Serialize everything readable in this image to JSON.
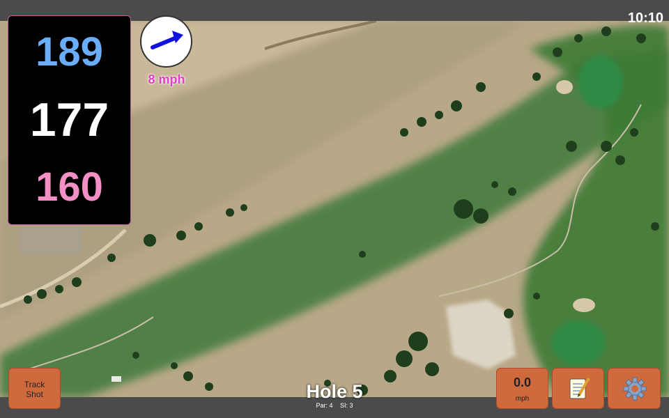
{
  "status": {
    "time": "10:10"
  },
  "distances": {
    "back": "189",
    "middle": "177",
    "front": "160",
    "colors": {
      "back": "#6aaefa",
      "middle": "#ffffff",
      "front": "#f48fc6"
    }
  },
  "wind": {
    "speed_label": "8 mph",
    "direction_icon": "arrow-right-up-icon",
    "arrow_color": "#1010e0"
  },
  "map": {
    "style": "satellite",
    "colors": {
      "rough": "#b9a98a",
      "fairway": "#3f7a3a",
      "green": "#2f8a45",
      "trees": "#1f3f1c"
    }
  },
  "buttons": {
    "track_shot": "Track Shot",
    "speed_value": "0.0",
    "speed_unit": "mph",
    "notes_icon": "notepad-icon",
    "settings_icon": "gear-icon",
    "color": "#cf6a3c"
  },
  "hole": {
    "title": "Hole 5",
    "par": "Par: 4",
    "si": "SI: 3"
  }
}
